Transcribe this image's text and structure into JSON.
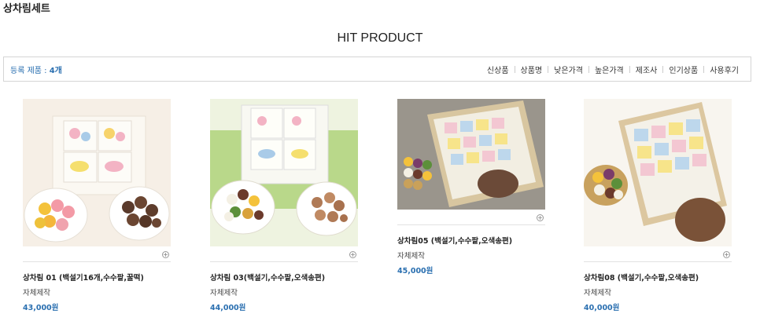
{
  "category_title": "상차림세트",
  "section_title": "HIT PRODUCT",
  "sort_bar": {
    "count_label": "등록 제품 : ",
    "count_value": "4개",
    "options": [
      "신상품",
      "상품명",
      "낮은가격",
      "높은가격",
      "제조사",
      "인기상품",
      "사용후기"
    ]
  },
  "products": [
    {
      "name": "상차림 01 (백설기16개,수수팥,꿀떡)",
      "maker": "자체제작",
      "price": "43,000원",
      "zoom": "+"
    },
    {
      "name": "상차림 03(백설기,수수팥,오색송편)",
      "maker": "자체제작",
      "price": "44,000원",
      "zoom": "+"
    },
    {
      "name": "상차림05 (백설기,수수팥,오색송편)",
      "maker": "자체제작",
      "price": "45,000원",
      "zoom": "+"
    },
    {
      "name": "상차림08 (백설기,수수팥,오색송편)",
      "maker": "자체제작",
      "price": "40,000원",
      "zoom": "+"
    }
  ]
}
